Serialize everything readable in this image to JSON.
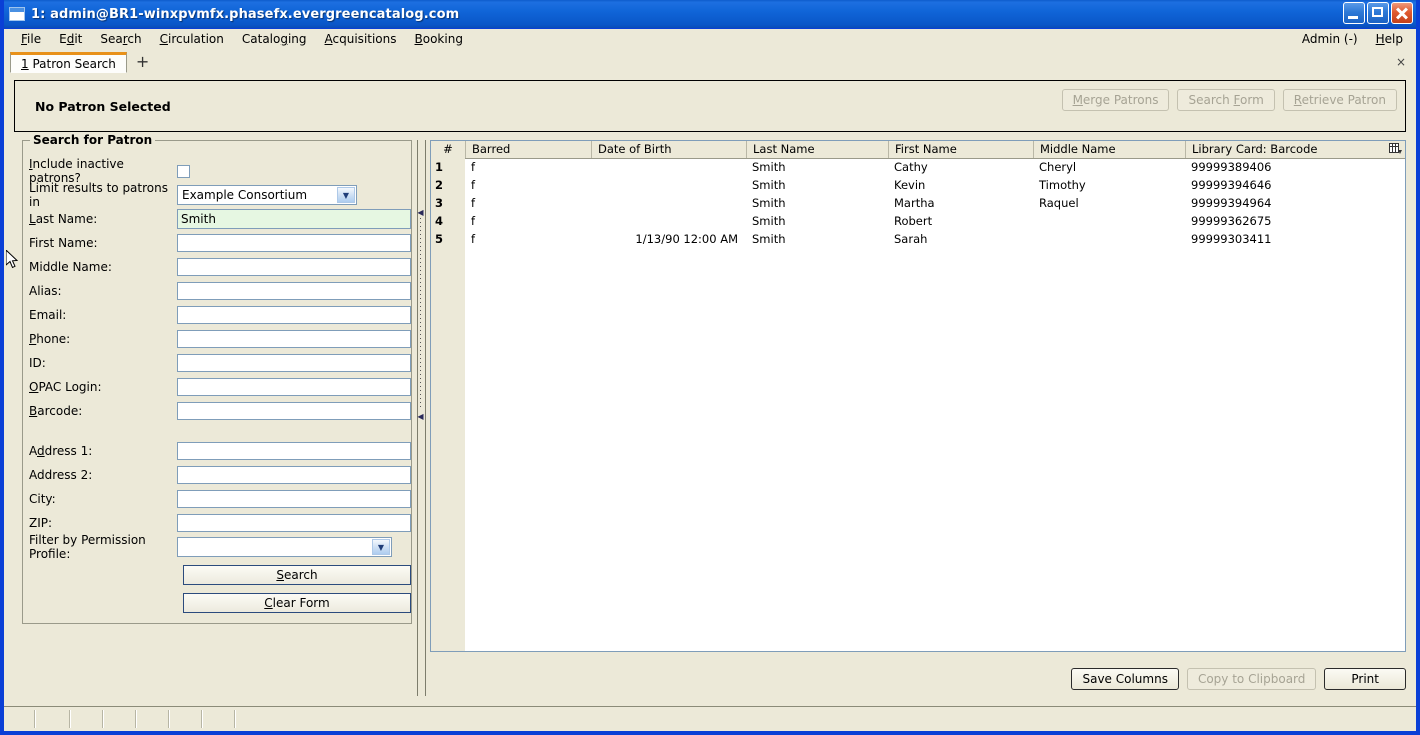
{
  "window": {
    "title": "1: admin@BR1-winxpvmfx.phasefx.evergreencatalog.com",
    "icon": "window-icon",
    "minimize": "minimize-icon",
    "maximize": "maximize-icon",
    "close": "close-icon"
  },
  "menubar": {
    "items": [
      {
        "label": "File",
        "accel": "F"
      },
      {
        "label": "Edit",
        "accel": "E"
      },
      {
        "label": "Search",
        "accel": "r"
      },
      {
        "label": "Circulation",
        "accel": "C"
      },
      {
        "label": "Cataloging",
        "accel": "g"
      },
      {
        "label": "Acquisitions",
        "accel": "A"
      },
      {
        "label": "Booking",
        "accel": "B"
      }
    ],
    "right": [
      {
        "label": "Admin (-)"
      },
      {
        "label": "Help",
        "accel": "H"
      }
    ]
  },
  "tabs": {
    "active": "1 Patron Search",
    "new_tab": "+",
    "close_all": "×"
  },
  "patron_bar": {
    "status": "No Patron Selected",
    "buttons": [
      {
        "label": "Merge Patrons",
        "enabled": false
      },
      {
        "label": "Search Form",
        "enabled": false
      },
      {
        "label": "Retrieve Patron",
        "enabled": false
      }
    ]
  },
  "search_form": {
    "legend": "Search for Patron",
    "include_inactive_label": "Include inactive patrons?",
    "include_inactive_checked": false,
    "limit_label": "Limit results to patrons in",
    "limit_value": "Example Consortium",
    "fields": [
      {
        "label": "Last Name:",
        "value": "Smith",
        "focused": true
      },
      {
        "label": "First Name:",
        "value": "",
        "focused": false
      },
      {
        "label": "Middle Name:",
        "value": "",
        "focused": false
      },
      {
        "label": "Alias:",
        "value": "",
        "focused": false
      },
      {
        "label": "Email:",
        "value": "",
        "focused": false
      },
      {
        "label": "Phone:",
        "value": "",
        "focused": false
      },
      {
        "label": "ID:",
        "value": "",
        "focused": false
      },
      {
        "label": "OPAC Login:",
        "value": "",
        "focused": false
      },
      {
        "label": "Barcode:",
        "value": "",
        "focused": false
      }
    ],
    "address_fields": [
      {
        "label": "Address 1:",
        "value": ""
      },
      {
        "label": "Address 2:",
        "value": ""
      },
      {
        "label": "City:",
        "value": ""
      },
      {
        "label": "ZIP:",
        "value": ""
      }
    ],
    "permission_label": "Filter by Permission Profile:",
    "permission_value": "",
    "search_button": "Search",
    "clear_button": "Clear Form"
  },
  "results": {
    "columns": [
      "#",
      "Barred",
      "Date of Birth",
      "Last Name",
      "First Name",
      "Middle Name",
      "Library Card: Barcode"
    ],
    "column_picker_icon": "column-picker-icon",
    "rows": [
      {
        "num": "1",
        "barred": "f",
        "dob": "",
        "last": "Smith",
        "first": "Cathy",
        "middle": "Cheryl",
        "barcode": "99999389406"
      },
      {
        "num": "2",
        "barred": "f",
        "dob": "",
        "last": "Smith",
        "first": "Kevin",
        "middle": "Timothy",
        "barcode": "99999394646"
      },
      {
        "num": "3",
        "barred": "f",
        "dob": "",
        "last": "Smith",
        "first": "Martha",
        "middle": "Raquel",
        "barcode": "99999394964"
      },
      {
        "num": "4",
        "barred": "f",
        "dob": "",
        "last": "Smith",
        "first": "Robert",
        "middle": "",
        "barcode": "99999362675"
      },
      {
        "num": "5",
        "barred": "f",
        "dob": "1/13/90 12:00 AM",
        "last": "Smith",
        "first": "Sarah",
        "middle": "",
        "barcode": "99999303411"
      }
    ],
    "actions": [
      {
        "label": "Save Columns",
        "enabled": true
      },
      {
        "label": "Copy to Clipboard",
        "enabled": false
      },
      {
        "label": "Print",
        "enabled": true
      }
    ]
  },
  "colors": {
    "titlebar_blue": "#1065d8",
    "window_border": "#0a3fd6",
    "chrome_beige": "#ece9d8",
    "tab_accent": "#e8911a",
    "focused_field": "#e6f7e2",
    "field_border": "#7f9db9"
  }
}
